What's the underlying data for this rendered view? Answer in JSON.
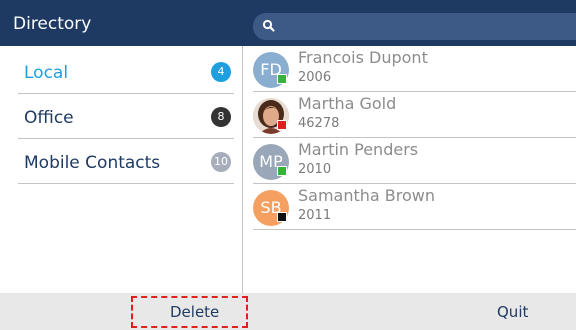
{
  "header": {
    "title": "Directory",
    "search_icon": "search-icon"
  },
  "sidebar": {
    "items": [
      {
        "label": "Local",
        "count": "4",
        "badge_color": "#1ea0e0",
        "active": true
      },
      {
        "label": "Office",
        "count": "8",
        "badge_color": "#333333",
        "active": false
      },
      {
        "label": "Mobile Contacts",
        "count": "10",
        "badge_color": "#a6aebb",
        "active": false
      }
    ]
  },
  "contacts": [
    {
      "initials": "FD",
      "name": "Francois Dupont",
      "ext": "2006",
      "avatar_color": "#8aaed0",
      "status_color": "#3bb03b"
    },
    {
      "initials": "",
      "name": "Martha Gold",
      "ext": "46278",
      "avatar_color": "#b8866a",
      "status_color": "#e02020",
      "photo": true
    },
    {
      "initials": "MP",
      "name": "Martin Penders",
      "ext": "2010",
      "avatar_color": "#9aa7b8",
      "status_color": "#3bb03b"
    },
    {
      "initials": "SB",
      "name": "Samantha Brown",
      "ext": "2011",
      "avatar_color": "#f5a060",
      "status_color": "#111111"
    }
  ],
  "footer": {
    "delete_label": "Delete",
    "quit_label": "Quit"
  }
}
